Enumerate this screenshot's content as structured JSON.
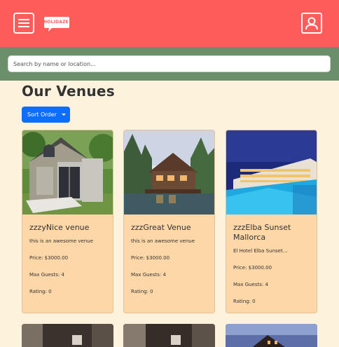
{
  "header": {
    "menu_icon": "hamburger-menu-icon",
    "logo_text": "HOLIDAZE",
    "profile_icon": "user-profile-icon",
    "bg_color": "#fe5b5b"
  },
  "search": {
    "placeholder": "Search by name or location..."
  },
  "main": {
    "title": "Our Venues",
    "sort_label": "Sort Order",
    "accent": "#0d6efd"
  },
  "venues": [
    {
      "name": "zzzyNice venue",
      "description": "this is an awesome venue",
      "price": "Price: $3000.00",
      "guests": "Max Guests: 4",
      "rating": "Rating: 0"
    },
    {
      "name": "zzzGreat Venue",
      "description": "this is an awesome venue",
      "price": "Price: $3000.00",
      "guests": "Max Guests: 4",
      "rating": "Rating: 0"
    },
    {
      "name": "zzzElba Sunset Mallorca",
      "description": "El Hotel Elba Sunset…",
      "price": "Price: $3000.00",
      "guests": "Max Guests: 4",
      "rating": "Rating: 0"
    }
  ]
}
